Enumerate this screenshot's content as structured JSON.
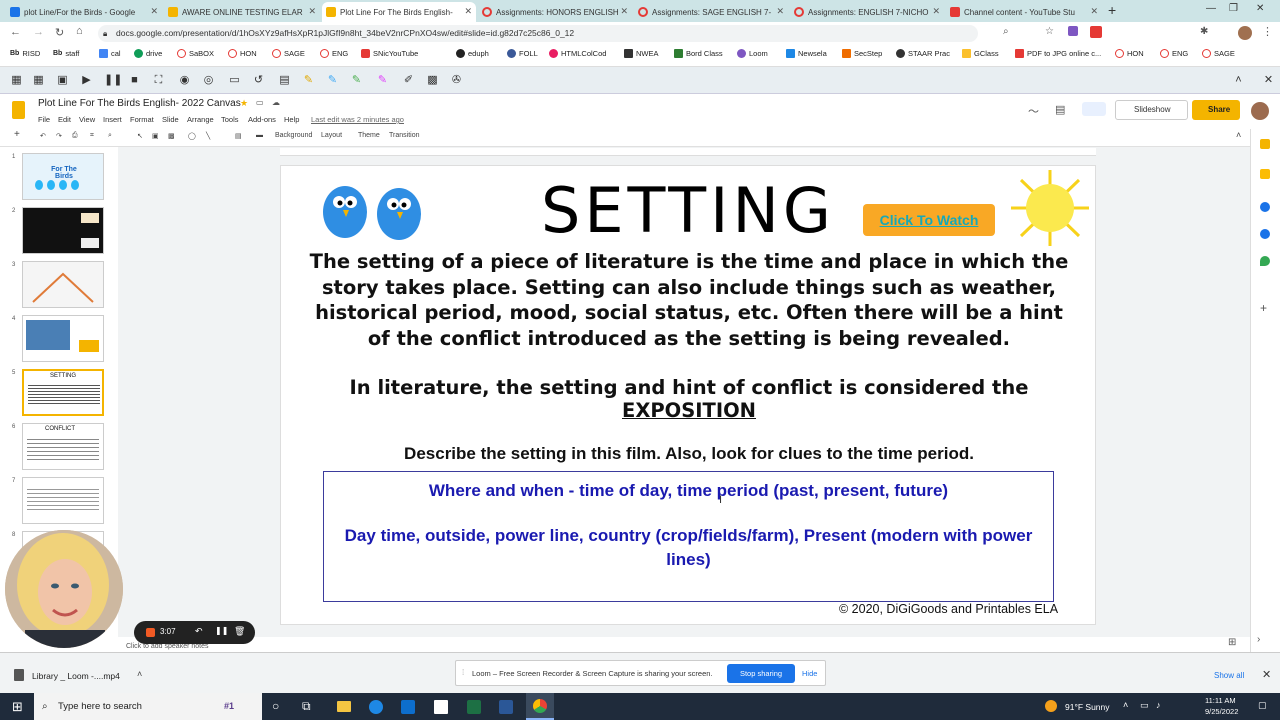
{
  "browser": {
    "tabs": [
      {
        "label": "plot Line/For the Birds - Google",
        "color": "#1a73e8"
      },
      {
        "label": "AWARE ONLINE TESTING ELAR",
        "color": "#f4b400"
      },
      {
        "label": "Plot Line For The Birds English-",
        "color": "#f4b400"
      },
      {
        "label": "Assignments: HONORS ENGLISH",
        "color": "#e53935"
      },
      {
        "label": "Assignments: SAGE ENGLISH 7-",
        "color": "#e53935"
      },
      {
        "label": "Assignments: ENGLISH 7-NICHO",
        "color": "#e53935"
      },
      {
        "label": "Channel content - YouTube Stu",
        "color": "#e53935"
      }
    ],
    "new_tab": "+",
    "url": "docs.google.com/presentation/d/1hOsXYz9afHsXpR1pJlGfI9n8ht_34beV2nrCPnXO4sw/edit#slide=id.g82d7c25c86_0_12",
    "bookmarks": [
      "RISD",
      "staff",
      "cal",
      "drive",
      "SaBOX",
      "HON",
      "SAGE",
      "ENG",
      "SNicYouTube",
      "eduph",
      "FOLL",
      "HTMLColCod",
      "NWEA",
      "Bord Class",
      "Loom",
      "Newsela",
      "SecStep",
      "STAAR Prac",
      "GClass",
      "PDF to JPG online c...",
      "HON",
      "ENG",
      "SAGE"
    ]
  },
  "slides": {
    "doc_title": "Plot Line For The Birds English- 2022 Canvas",
    "menu": [
      "File",
      "Edit",
      "View",
      "Insert",
      "Format",
      "Slide",
      "Arrange",
      "Tools",
      "Add-ons",
      "Help"
    ],
    "last_edit": "Last edit was 2 minutes ago",
    "slideshow_label": "Slideshow",
    "share_label": "Share",
    "toolbar": [
      "Background",
      "Layout",
      "Theme",
      "Transition"
    ],
    "notes_placeholder": "Click to add speaker notes"
  },
  "slide": {
    "title": "SETTING",
    "watch_button": "Click To Watch",
    "definition": "The setting of a piece of literature is the time and place in which the story takes place. Setting can also include things such as weather, historical period, mood, social status, etc.  Often there will be a hint of the conflict introduced as the setting is being revealed.",
    "exposition_prefix": "In literature, the setting and hint of conflict is considered the ",
    "exposition_word": "EXPOSITION",
    "prompt": "Describe the setting in this film. Also,  look for clues to the time period.",
    "box_line1": "Where and when - time of day, time period (past, present, future)",
    "box_line2": "Day time, outside, power line, country (crop/fields/farm), Present (modern with power lines)",
    "copyright": "© 2020, DiGiGoods and Printables ELA"
  },
  "thumbs": [
    {
      "num": "1",
      "title": "For The Birds"
    },
    {
      "num": "2",
      "title": ""
    },
    {
      "num": "3",
      "title": ""
    },
    {
      "num": "4",
      "title": ""
    },
    {
      "num": "5",
      "title": "SETTING"
    },
    {
      "num": "6",
      "title": "CONFLICT"
    },
    {
      "num": "7",
      "title": ""
    },
    {
      "num": "8",
      "title": ""
    }
  ],
  "recorder": {
    "time": "3:07"
  },
  "download": {
    "file": "Library _ Loom -....mp4",
    "show_all": "Show all"
  },
  "loom_notice": {
    "text": "Loom – Free Screen Recorder & Screen Capture is sharing your screen.",
    "stop": "Stop sharing",
    "hide": "Hide"
  },
  "taskbar": {
    "search_placeholder": "Type here to search",
    "weather": "91°F  Sunny",
    "time": "11:11 AM",
    "date": "9/25/2022"
  }
}
